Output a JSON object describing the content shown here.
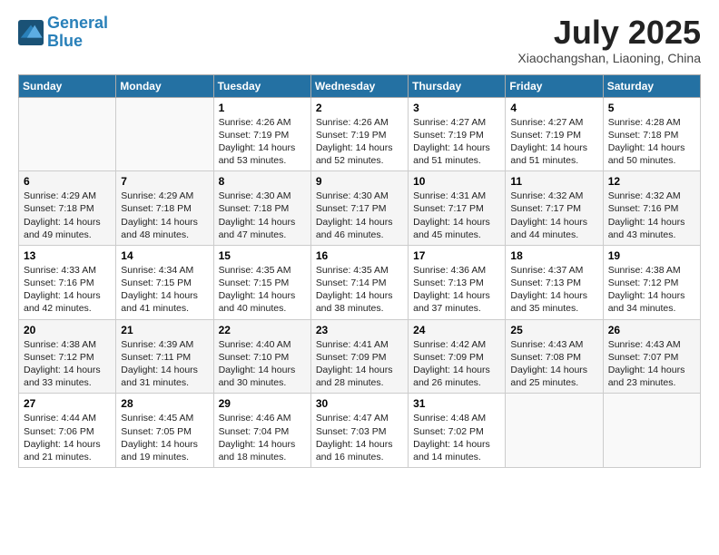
{
  "header": {
    "logo_line1": "General",
    "logo_line2": "Blue",
    "month_title": "July 2025",
    "location": "Xiaochangshan, Liaoning, China"
  },
  "days_of_week": [
    "Sunday",
    "Monday",
    "Tuesday",
    "Wednesday",
    "Thursday",
    "Friday",
    "Saturday"
  ],
  "weeks": [
    [
      {
        "day": "",
        "info": ""
      },
      {
        "day": "",
        "info": ""
      },
      {
        "day": "1",
        "sunrise": "Sunrise: 4:26 AM",
        "sunset": "Sunset: 7:19 PM",
        "daylight": "Daylight: 14 hours and 53 minutes."
      },
      {
        "day": "2",
        "sunrise": "Sunrise: 4:26 AM",
        "sunset": "Sunset: 7:19 PM",
        "daylight": "Daylight: 14 hours and 52 minutes."
      },
      {
        "day": "3",
        "sunrise": "Sunrise: 4:27 AM",
        "sunset": "Sunset: 7:19 PM",
        "daylight": "Daylight: 14 hours and 51 minutes."
      },
      {
        "day": "4",
        "sunrise": "Sunrise: 4:27 AM",
        "sunset": "Sunset: 7:19 PM",
        "daylight": "Daylight: 14 hours and 51 minutes."
      },
      {
        "day": "5",
        "sunrise": "Sunrise: 4:28 AM",
        "sunset": "Sunset: 7:18 PM",
        "daylight": "Daylight: 14 hours and 50 minutes."
      }
    ],
    [
      {
        "day": "6",
        "sunrise": "Sunrise: 4:29 AM",
        "sunset": "Sunset: 7:18 PM",
        "daylight": "Daylight: 14 hours and 49 minutes."
      },
      {
        "day": "7",
        "sunrise": "Sunrise: 4:29 AM",
        "sunset": "Sunset: 7:18 PM",
        "daylight": "Daylight: 14 hours and 48 minutes."
      },
      {
        "day": "8",
        "sunrise": "Sunrise: 4:30 AM",
        "sunset": "Sunset: 7:18 PM",
        "daylight": "Daylight: 14 hours and 47 minutes."
      },
      {
        "day": "9",
        "sunrise": "Sunrise: 4:30 AM",
        "sunset": "Sunset: 7:17 PM",
        "daylight": "Daylight: 14 hours and 46 minutes."
      },
      {
        "day": "10",
        "sunrise": "Sunrise: 4:31 AM",
        "sunset": "Sunset: 7:17 PM",
        "daylight": "Daylight: 14 hours and 45 minutes."
      },
      {
        "day": "11",
        "sunrise": "Sunrise: 4:32 AM",
        "sunset": "Sunset: 7:17 PM",
        "daylight": "Daylight: 14 hours and 44 minutes."
      },
      {
        "day": "12",
        "sunrise": "Sunrise: 4:32 AM",
        "sunset": "Sunset: 7:16 PM",
        "daylight": "Daylight: 14 hours and 43 minutes."
      }
    ],
    [
      {
        "day": "13",
        "sunrise": "Sunrise: 4:33 AM",
        "sunset": "Sunset: 7:16 PM",
        "daylight": "Daylight: 14 hours and 42 minutes."
      },
      {
        "day": "14",
        "sunrise": "Sunrise: 4:34 AM",
        "sunset": "Sunset: 7:15 PM",
        "daylight": "Daylight: 14 hours and 41 minutes."
      },
      {
        "day": "15",
        "sunrise": "Sunrise: 4:35 AM",
        "sunset": "Sunset: 7:15 PM",
        "daylight": "Daylight: 14 hours and 40 minutes."
      },
      {
        "day": "16",
        "sunrise": "Sunrise: 4:35 AM",
        "sunset": "Sunset: 7:14 PM",
        "daylight": "Daylight: 14 hours and 38 minutes."
      },
      {
        "day": "17",
        "sunrise": "Sunrise: 4:36 AM",
        "sunset": "Sunset: 7:13 PM",
        "daylight": "Daylight: 14 hours and 37 minutes."
      },
      {
        "day": "18",
        "sunrise": "Sunrise: 4:37 AM",
        "sunset": "Sunset: 7:13 PM",
        "daylight": "Daylight: 14 hours and 35 minutes."
      },
      {
        "day": "19",
        "sunrise": "Sunrise: 4:38 AM",
        "sunset": "Sunset: 7:12 PM",
        "daylight": "Daylight: 14 hours and 34 minutes."
      }
    ],
    [
      {
        "day": "20",
        "sunrise": "Sunrise: 4:38 AM",
        "sunset": "Sunset: 7:12 PM",
        "daylight": "Daylight: 14 hours and 33 minutes."
      },
      {
        "day": "21",
        "sunrise": "Sunrise: 4:39 AM",
        "sunset": "Sunset: 7:11 PM",
        "daylight": "Daylight: 14 hours and 31 minutes."
      },
      {
        "day": "22",
        "sunrise": "Sunrise: 4:40 AM",
        "sunset": "Sunset: 7:10 PM",
        "daylight": "Daylight: 14 hours and 30 minutes."
      },
      {
        "day": "23",
        "sunrise": "Sunrise: 4:41 AM",
        "sunset": "Sunset: 7:09 PM",
        "daylight": "Daylight: 14 hours and 28 minutes."
      },
      {
        "day": "24",
        "sunrise": "Sunrise: 4:42 AM",
        "sunset": "Sunset: 7:09 PM",
        "daylight": "Daylight: 14 hours and 26 minutes."
      },
      {
        "day": "25",
        "sunrise": "Sunrise: 4:43 AM",
        "sunset": "Sunset: 7:08 PM",
        "daylight": "Daylight: 14 hours and 25 minutes."
      },
      {
        "day": "26",
        "sunrise": "Sunrise: 4:43 AM",
        "sunset": "Sunset: 7:07 PM",
        "daylight": "Daylight: 14 hours and 23 minutes."
      }
    ],
    [
      {
        "day": "27",
        "sunrise": "Sunrise: 4:44 AM",
        "sunset": "Sunset: 7:06 PM",
        "daylight": "Daylight: 14 hours and 21 minutes."
      },
      {
        "day": "28",
        "sunrise": "Sunrise: 4:45 AM",
        "sunset": "Sunset: 7:05 PM",
        "daylight": "Daylight: 14 hours and 19 minutes."
      },
      {
        "day": "29",
        "sunrise": "Sunrise: 4:46 AM",
        "sunset": "Sunset: 7:04 PM",
        "daylight": "Daylight: 14 hours and 18 minutes."
      },
      {
        "day": "30",
        "sunrise": "Sunrise: 4:47 AM",
        "sunset": "Sunset: 7:03 PM",
        "daylight": "Daylight: 14 hours and 16 minutes."
      },
      {
        "day": "31",
        "sunrise": "Sunrise: 4:48 AM",
        "sunset": "Sunset: 7:02 PM",
        "daylight": "Daylight: 14 hours and 14 minutes."
      },
      {
        "day": "",
        "info": ""
      },
      {
        "day": "",
        "info": ""
      }
    ]
  ]
}
